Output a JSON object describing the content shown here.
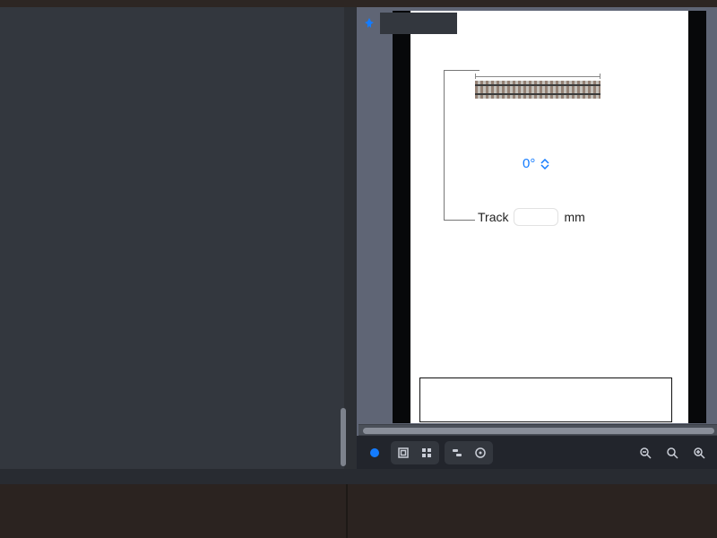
{
  "panel": {
    "angle_value": "0°",
    "measure_label": "Track",
    "measure_value": "",
    "measure_unit": "mm"
  },
  "icons": {
    "pin": "pin-icon",
    "record": "record-icon",
    "layers": "layers-icon",
    "grid": "grid-icon",
    "widgets": "widgets-icon",
    "target": "target-icon",
    "zoom_out": "zoom-out-icon",
    "zoom_fit": "zoom-fit-icon",
    "zoom_in": "zoom-in-icon"
  },
  "colors": {
    "accent": "#147cff"
  }
}
